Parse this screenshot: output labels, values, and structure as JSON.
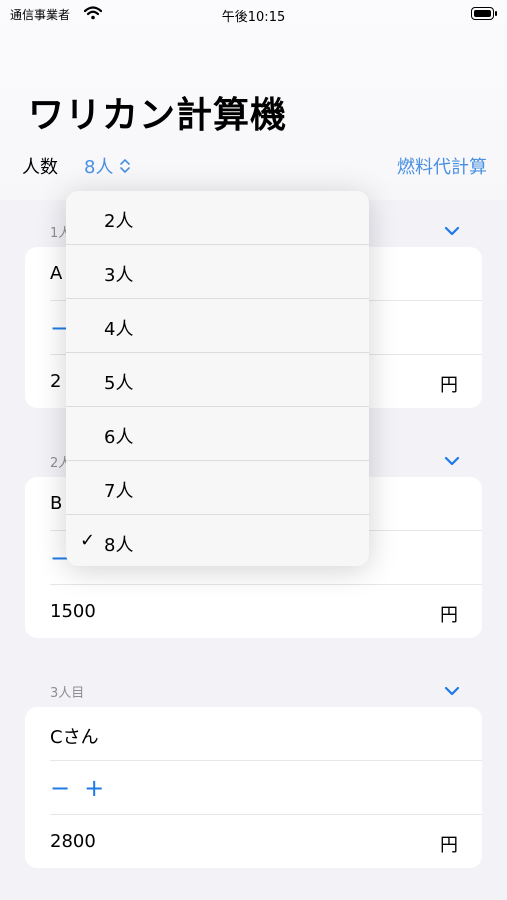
{
  "status_bar": {
    "carrier": "通信事業者",
    "time": "午後10:15"
  },
  "header": {
    "title": "ワリカン計算機",
    "people_label": "人数",
    "people_value": "8人",
    "fuel_link": "燃料代計算"
  },
  "sections": [
    {
      "header": "1人目",
      "name": "A",
      "amount": "2",
      "currency": "円"
    },
    {
      "header": "2人目",
      "name": "B",
      "amount": "1500",
      "currency": "円"
    },
    {
      "header": "3人目",
      "name": "Cさん",
      "amount": "2800",
      "currency": "円"
    }
  ],
  "stepper": {
    "minus": "−",
    "plus": "+"
  },
  "dropdown": {
    "options": [
      "2人",
      "3人",
      "4人",
      "5人",
      "6人",
      "7人",
      "8人"
    ],
    "selected": "8人",
    "check": "✓"
  },
  "colors": {
    "accent": "#4a90e2",
    "stepper": "#1e7ae6",
    "background": "#f2f2f7"
  }
}
